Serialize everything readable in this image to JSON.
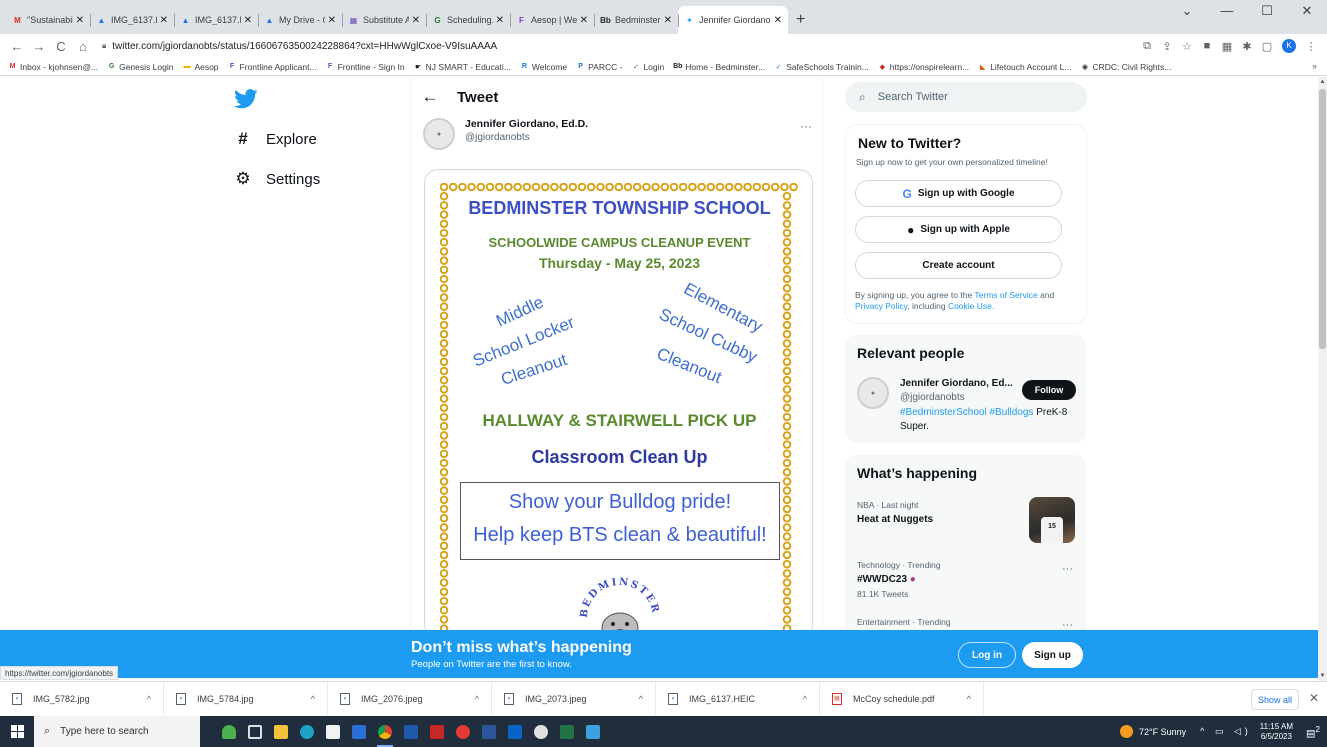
{
  "browser": {
    "tabs": [
      {
        "title": "\"Sustainability artifact",
        "icon": "gmail",
        "color": "#d93025"
      },
      {
        "title": "IMG_6137.HEIC - Goo",
        "icon": "drive",
        "color": "#1a73e8"
      },
      {
        "title": "IMG_6137.HEIC - Goo",
        "icon": "drive",
        "color": "#1a73e8"
      },
      {
        "title": "My Drive - Google Dri",
        "icon": "drive",
        "color": "#1a73e8"
      },
      {
        "title": "Substitute Availability",
        "icon": "calendar",
        "color": "#6b4bbd"
      },
      {
        "title": "Scheduling.Modify Se",
        "icon": "genesis",
        "color": "#2e7d32"
      },
      {
        "title": "Aesop | Web Navigato",
        "icon": "frontline",
        "color": "#7b3fbf"
      },
      {
        "title": "Bedminster Township",
        "icon": "bb",
        "color": "#222222"
      },
      {
        "title": "Jennifer Giordano, Ed",
        "icon": "twitter",
        "color": "#1d9bf0",
        "active": true
      }
    ],
    "new_tab": "+",
    "url": "twitter.com/jgiordanobts/status/1660676350024228864?cxt=HHwWglCxoe-V9IsuAAAA",
    "bookmarks": [
      {
        "label": "Inbox - kjohnsen@...",
        "icon": "gmail"
      },
      {
        "label": "Genesis Login",
        "icon": "genesis"
      },
      {
        "label": "Aesop",
        "icon": "folder"
      },
      {
        "label": "Frontline Applicant...",
        "icon": "frontline"
      },
      {
        "label": "Frontline - Sign In",
        "icon": "frontline"
      },
      {
        "label": "NJ SMART - Educati...",
        "icon": "njsmart"
      },
      {
        "label": "Welcome",
        "icon": "welcome"
      },
      {
        "label": "PARCC -",
        "icon": "parcc"
      },
      {
        "label": "Login",
        "icon": "login"
      },
      {
        "label": "Home - Bedminster...",
        "icon": "bb"
      },
      {
        "label": "SafeSchools Trainin...",
        "icon": "check"
      },
      {
        "label": "https://onspirelearn...",
        "icon": "onspire"
      },
      {
        "label": "Lifetouch Account L...",
        "icon": "lifetouch"
      },
      {
        "label": "CRDC: Civil Rights...",
        "icon": "globe"
      }
    ],
    "bookmarks_more": "»",
    "status_url": "https://twitter.com/jgiordanobts"
  },
  "nav": {
    "explore": "Explore",
    "settings": "Settings"
  },
  "tweet": {
    "header": "Tweet",
    "author_name": "Jennifer Giordano, Ed.D.",
    "author_handle": "@jgiordanobts",
    "more": "···"
  },
  "poster": {
    "school": "BEDMINSTER TOWNSHIP SCHOOL",
    "event": "SCHOOLWIDE CAMPUS CLEANUP EVENT",
    "date": "Thursday - May 25, 2023",
    "middle": [
      "Middle",
      "School Locker",
      "Cleanout"
    ],
    "elementary": [
      "Elementary",
      "School Cubby",
      "Cleanout"
    ],
    "hallway": "HALLWAY & STAIRWELL PICK UP",
    "classroom": "Classroom Clean Up",
    "pride": "Show your Bulldog pride!",
    "keep": "Help keep BTS clean & beautiful!",
    "seal_text": "BEDMINSTER"
  },
  "sidebar": {
    "search_placeholder": "Search Twitter",
    "new_title": "New to Twitter?",
    "new_sub": "Sign up now to get your own personalized timeline!",
    "google": "Sign up with Google",
    "apple": "Sign up with Apple",
    "create": "Create account",
    "terms_pre": "By signing up, you agree to the",
    "terms_tos": "Terms of Service",
    "terms_and": "and",
    "terms_privacy": "Privacy Policy",
    "terms_incl": ", including",
    "terms_cookie": "Cookie Use.",
    "relevant_title": "Relevant people",
    "rel_name": "Jennifer Giordano, Ed...",
    "rel_handle": "@jgiordanobts",
    "rel_tag1": "#BedminsterSchool",
    "rel_tag2": "#Bulldogs",
    "rel_bio": "PreK-8 Super.",
    "follow": "Follow",
    "happening_title": "What’s happening",
    "trends": [
      {
        "context": "NBA · Last night",
        "title": "Heat at Nuggets",
        "count": ""
      },
      {
        "context": "Technology · Trending",
        "title": "#WWDC23",
        "count": "81.1K Tweets"
      },
      {
        "context": "Entertainment · Trending",
        "title": "",
        "count": ""
      }
    ],
    "jersey_number": "15"
  },
  "banner": {
    "title": "Don’t miss what’s happening",
    "subtitle": "People on Twitter are the first to know.",
    "login": "Log in",
    "signup": "Sign up"
  },
  "downloads": {
    "items": [
      "IMG_5782.jpg",
      "IMG_5784.jpg",
      "IMG_2076.jpeg",
      "IMG_2073.jpeg",
      "IMG_6137.HEIC",
      "McCoy schedule.pdf"
    ],
    "show_all": "Show all"
  },
  "taskbar": {
    "search": "Type here to search",
    "weather": "72°F  Sunny",
    "time": "11:15 AM",
    "date": "6/5/2023",
    "notif_count": "2"
  },
  "colors": {
    "twitter_blue": "#1d9bf0",
    "poster_blue": "#3d4fc4",
    "poster_green": "#5a8a2e",
    "bead_gold": "#d9a21b"
  }
}
